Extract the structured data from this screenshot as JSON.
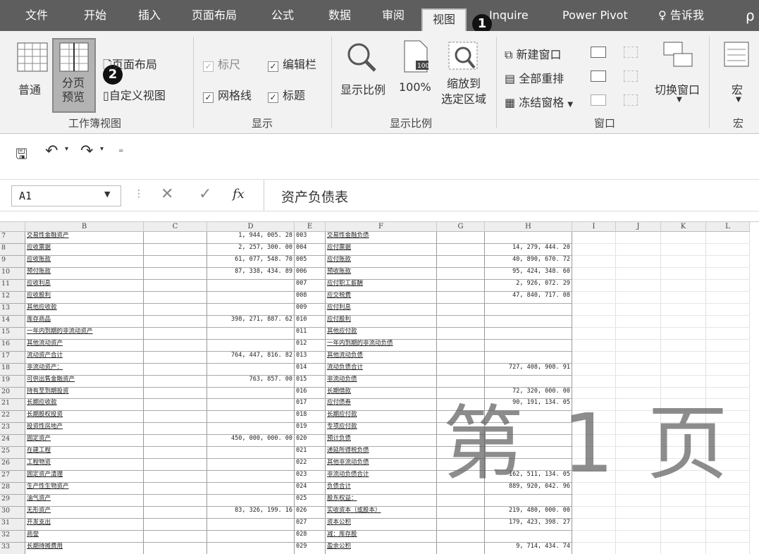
{
  "tabs": [
    "文件",
    "开始",
    "插入",
    "页面布局",
    "公式",
    "数据",
    "审阅",
    "视图",
    "Inquire",
    "Power Pivot",
    "告诉我"
  ],
  "tab_tell_icon": "lightbulb-icon",
  "ribbon": {
    "workbook_views": {
      "normal": "普通",
      "page_break": "分页\n预览",
      "page_layout": "页面布局",
      "custom": "自定义视图",
      "label": "工作簿视图"
    },
    "show": {
      "ruler": "标尺",
      "formula_bar": "编辑栏",
      "gridlines": "网格线",
      "headings": "标题",
      "label": "显示"
    },
    "zoom": {
      "zoom": "显示比例",
      "hundred": "100%",
      "to_selection": "缩放到\n选定区域",
      "label": "显示比例",
      "icon_text": "100"
    },
    "window": {
      "new_window": "新建窗口",
      "arrange": "全部重排",
      "freeze": "冻结窗格",
      "switch": "切换窗口",
      "label": "窗口"
    },
    "macro": {
      "macro": "宏",
      "label": "宏"
    }
  },
  "badges": [
    "1",
    "2"
  ],
  "formula": {
    "namebox": "A1",
    "fx": "fx",
    "content": "资产负债表"
  },
  "columns": [
    "B",
    "C",
    "D",
    "E",
    "F",
    "G",
    "H",
    "I",
    "J",
    "K",
    "L"
  ],
  "rows": [
    {
      "n": "7",
      "b": "交易性金融资产",
      "d": "1, 944, 005. 28",
      "e": "003",
      "f": "交易性金融负债",
      "h": ""
    },
    {
      "n": "8",
      "b": "应收票据",
      "d": "2, 257, 300. 00",
      "e": "004",
      "f": "应付票据",
      "h": "14, 279, 444. 20"
    },
    {
      "n": "9",
      "b": "应收账款",
      "d": "61, 077, 548. 70",
      "e": "005",
      "f": "应付账款",
      "h": "40, 890, 670. 72"
    },
    {
      "n": "10",
      "b": "预付账款",
      "d": "87, 338, 434. 89",
      "e": "006",
      "f": "预收账款",
      "h": "95, 424, 348. 60"
    },
    {
      "n": "11",
      "b": "应收利息",
      "d": "",
      "e": "007",
      "f": "应付职工薪酬",
      "h": "2, 926, 072. 29"
    },
    {
      "n": "12",
      "b": "应收股利",
      "d": "",
      "e": "008",
      "f": "应交税费",
      "h": "47, 840, 717. 08"
    },
    {
      "n": "13",
      "b": "其他应收款",
      "d": "",
      "e": "009",
      "f": "应付利息",
      "h": ""
    },
    {
      "n": "14",
      "b": "库存商品",
      "d": "398, 271, 887. 62",
      "e": "010",
      "f": "应付股利",
      "h": ""
    },
    {
      "n": "15",
      "b": "一年内到期的非流动资产",
      "d": "",
      "e": "011",
      "f": "其他应付款",
      "h": ""
    },
    {
      "n": "16",
      "b": "其他流动资产",
      "d": "",
      "e": "012",
      "f": "一年内到期的非流动负债",
      "h": ""
    },
    {
      "n": "17",
      "b": "流动资产合计",
      "d": "764, 447, 816. 82",
      "e": "013",
      "f": "其他流动负债",
      "h": ""
    },
    {
      "n": "18",
      "b": "非流动资产：",
      "d": "",
      "e": "014",
      "f": "流动负债合计",
      "h": "727, 408, 908. 91"
    },
    {
      "n": "19",
      "b": "可供出售金融资产",
      "d": "763, 857. 00",
      "e": "015",
      "f": "非流动负债",
      "h": ""
    },
    {
      "n": "20",
      "b": "持有至到期投资",
      "d": "",
      "e": "016",
      "f": "长期借款",
      "h": "72, 320, 000. 00"
    },
    {
      "n": "21",
      "b": "长期应收款",
      "d": "",
      "e": "017",
      "f": "应付债券",
      "h": "90, 191, 134. 05"
    },
    {
      "n": "22",
      "b": "长期股权投资",
      "d": "",
      "e": "018",
      "f": "长期应付款",
      "h": ""
    },
    {
      "n": "23",
      "b": "投资性房地产",
      "d": "",
      "e": "019",
      "f": "专项应付款",
      "h": ""
    },
    {
      "n": "24",
      "b": "固定资产",
      "d": "450, 000, 000. 00",
      "e": "020",
      "f": "预计负债",
      "h": ""
    },
    {
      "n": "25",
      "b": "在建工程",
      "d": "",
      "e": "021",
      "f": "递延所得税负债",
      "h": ""
    },
    {
      "n": "26",
      "b": "工程物资",
      "d": "",
      "e": "022",
      "f": "其他非流动负债",
      "h": ""
    },
    {
      "n": "27",
      "b": "固定资产清理",
      "d": "",
      "e": "023",
      "f": "非流动负债合计",
      "h": "162, 511, 134. 05"
    },
    {
      "n": "28",
      "b": "生产性生物资产",
      "d": "",
      "e": "024",
      "f": "负债合计",
      "h": "889, 920, 042. 96"
    },
    {
      "n": "29",
      "b": "油气资产",
      "d": "",
      "e": "025",
      "f": "股东权益：",
      "h": ""
    },
    {
      "n": "30",
      "b": "无形资产",
      "d": "83, 326, 199. 16",
      "e": "026",
      "f": "实收资本（或股本）",
      "h": "219, 480, 000. 00"
    },
    {
      "n": "31",
      "b": "开发支出",
      "d": "",
      "e": "027",
      "f": "资本公积",
      "h": "179, 423, 398. 27"
    },
    {
      "n": "32",
      "b": "商誉",
      "d": "",
      "e": "028",
      "f": "减：库存股",
      "h": ""
    },
    {
      "n": "33",
      "b": "长期待摊费用",
      "d": "",
      "e": "029",
      "f": "盈余公积",
      "h": "9, 714, 434. 74"
    }
  ],
  "watermark": [
    "第",
    "1",
    "页"
  ]
}
